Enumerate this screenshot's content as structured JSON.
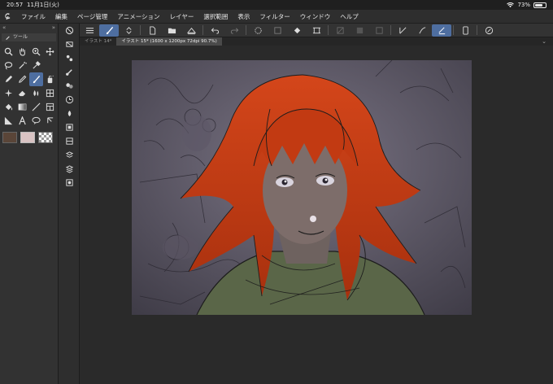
{
  "status": {
    "time": "20:57",
    "date": "11月1日(火)",
    "battery": "73%",
    "battery_level": 0.73
  },
  "menu": [
    "ファイル",
    "編集",
    "ページ管理",
    "アニメーション",
    "レイヤー",
    "選択範囲",
    "表示",
    "フィルター",
    "ウィンドウ",
    "ヘルプ"
  ],
  "toolpanel": {
    "tab_label": "ツール"
  },
  "tabs": [
    {
      "label": "イラスト 14*"
    },
    {
      "label": "イラスト 15* (1600 x 1200px 72dpi 90.7%)"
    }
  ],
  "colors": {
    "accent": "#4e6ea0",
    "main_color": "#5a4538",
    "sub_color": "#d9c3c3",
    "hair": "#c23a12"
  },
  "icons": {
    "tools": [
      "zoom-icon",
      "hand-icon",
      "rotate-icon",
      "move-icon",
      "lasso-icon",
      "magic-wand-icon",
      "eyedropper-icon",
      "blank-icon",
      "pen-icon",
      "pencil-icon",
      "brush-icon",
      "airbrush-icon",
      "decoration-icon",
      "eraser-icon",
      "blend-icon",
      "fill-ruler-icon",
      "fill-icon",
      "gradient-icon",
      "figure-icon",
      "frame-icon",
      "ruler-icon",
      "text-icon",
      "balloon-icon",
      "link-icon"
    ],
    "subtools": [
      "navigator-icon",
      "layer-property-icon",
      "sub-tool-icon",
      "color-circle-icon",
      "material-icon",
      "history-icon",
      "layer-icon",
      "auto-action-icon",
      "brush-size-icon",
      "color-set-icon",
      "quick-access-icon",
      "layer-search-icon"
    ]
  }
}
